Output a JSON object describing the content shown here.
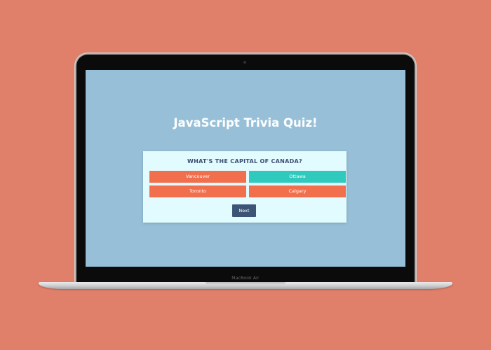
{
  "device": {
    "model_label": "MacBook Air"
  },
  "app": {
    "title": "JavaScript Trivia Quiz!",
    "question": "WHAT'S THE CAPITAL OF CANADA?",
    "answers": [
      {
        "label": "Vancouver",
        "state": "wrong"
      },
      {
        "label": "Ottawa",
        "state": "correct"
      },
      {
        "label": "Toronto",
        "state": "wrong"
      },
      {
        "label": "Calgary",
        "state": "wrong"
      }
    ],
    "next_label": "Next"
  },
  "colors": {
    "background": "#e07f6a",
    "screen": "#97c0d8",
    "card": "#e2fbff",
    "wrong": "#f26f4e",
    "correct": "#2fcabd",
    "next_button": "#3c5476",
    "question_text": "#3c4e70"
  }
}
